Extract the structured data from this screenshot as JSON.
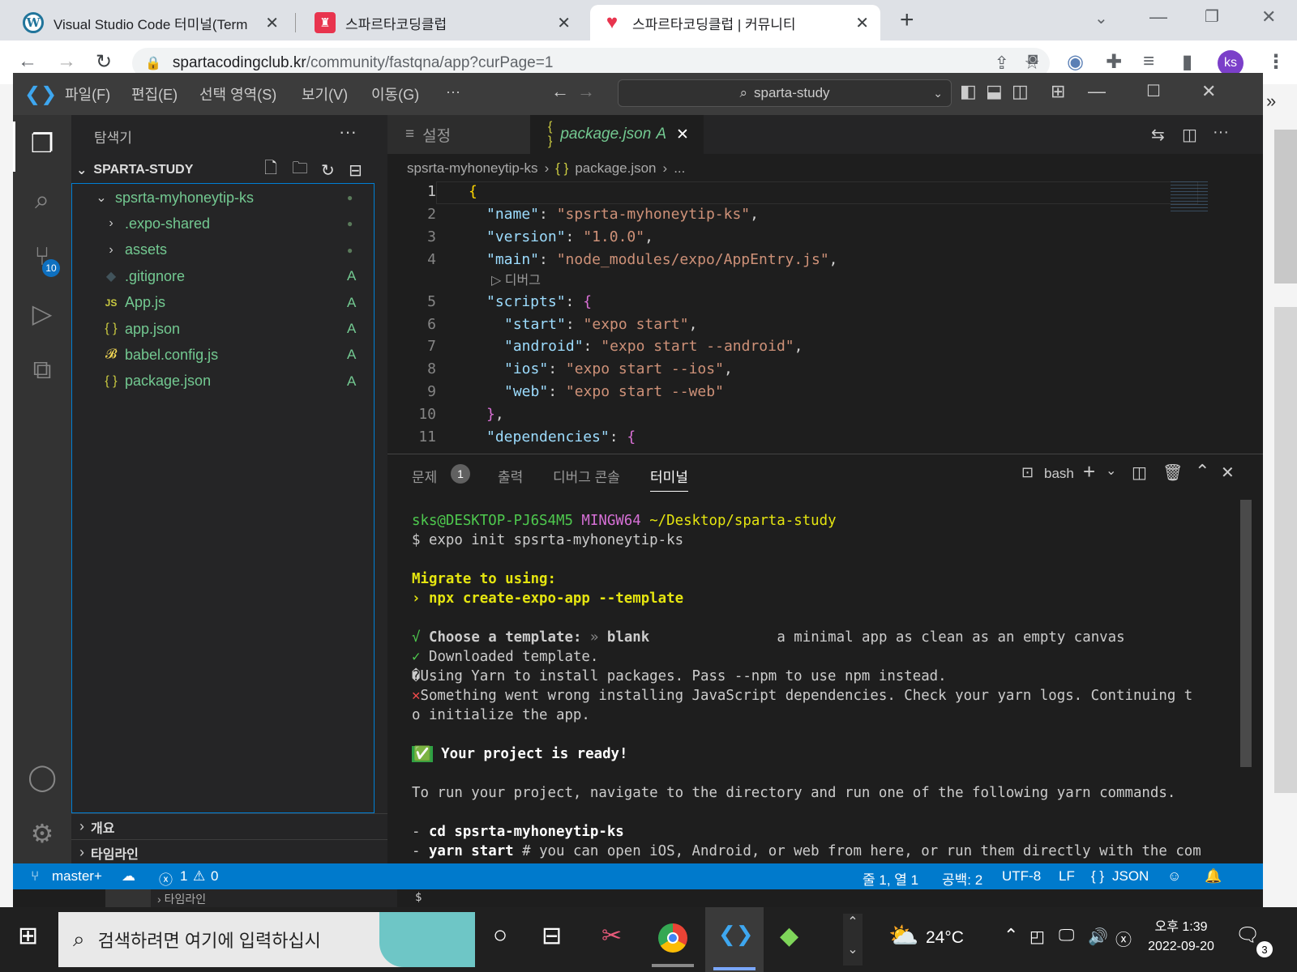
{
  "browser": {
    "tabs": [
      {
        "title": "Visual Studio Code 터미널(Term",
        "icon": "wordpress-icon"
      },
      {
        "title": "스파르타코딩클럽",
        "icon": "sparta-icon"
      },
      {
        "title": "스파르타코딩클럽 | 커뮤니티",
        "icon": "sparta-heart-icon"
      }
    ],
    "url_host": "spartacodingclub.kr",
    "url_path": "/community/fastqna/app?curPage=1",
    "profile": "ks"
  },
  "vscode": {
    "menu": [
      "파일(F)",
      "편집(E)",
      "선택 영역(S)",
      "보기(V)",
      "이동(G)",
      "···"
    ],
    "search": "sparta-study",
    "scm_badge": "10",
    "explorer_title": "탐색기",
    "workspace": "SPARTA-STUDY",
    "tree": [
      {
        "name": "spsrta-myhoneytip-ks",
        "kind": "folder-open",
        "badge": "●",
        "indent": 0
      },
      {
        "name": ".expo-shared",
        "kind": "folder",
        "badge": "●",
        "indent": 1
      },
      {
        "name": "assets",
        "kind": "folder",
        "badge": "●",
        "indent": 1
      },
      {
        "name": ".gitignore",
        "kind": "git",
        "badge": "A",
        "indent": 1
      },
      {
        "name": "App.js",
        "kind": "js",
        "badge": "A",
        "indent": 1
      },
      {
        "name": "app.json",
        "kind": "json",
        "badge": "A",
        "indent": 1
      },
      {
        "name": "babel.config.js",
        "kind": "babel",
        "badge": "A",
        "indent": 1
      },
      {
        "name": "package.json",
        "kind": "json",
        "badge": "A",
        "indent": 1
      }
    ],
    "outline_label": "개요",
    "timeline_label": "타임라인",
    "editor_tabs": [
      {
        "label": "설정"
      },
      {
        "label": "package.json",
        "badge": "A"
      }
    ],
    "breadcrumb": [
      "spsrta-myhoneytip-ks",
      "{ }",
      "package.json",
      "..."
    ],
    "codelens": "디버그",
    "panel_tabs": [
      "문제",
      "출력",
      "디버그 콘솔",
      "터미널"
    ],
    "problems_count": "1",
    "shell": "bash",
    "status": {
      "branch": "master+",
      "errors": "1",
      "warnings": "0",
      "position": "줄 1, 열 1",
      "spaces": "공백: 2",
      "encoding": "UTF-8",
      "eol": "LF",
      "language": "JSON"
    }
  },
  "code_lines": [
    {
      "n": "1",
      "text": "{"
    },
    {
      "n": "2",
      "text": "\"name\": \"spsrta-myhoneytip-ks\","
    },
    {
      "n": "3",
      "text": "\"version\": \"1.0.0\","
    },
    {
      "n": "4",
      "text": "\"main\": \"node_modules/expo/AppEntry.js\","
    },
    {
      "n": "5",
      "text": "\"scripts\": {"
    },
    {
      "n": "6",
      "text": "\"start\": \"expo start\","
    },
    {
      "n": "7",
      "text": "\"android\": \"expo start --android\","
    },
    {
      "n": "8",
      "text": "\"ios\": \"expo start --ios\","
    },
    {
      "n": "9",
      "text": "\"web\": \"expo start --web\""
    },
    {
      "n": "10",
      "text": "},"
    },
    {
      "n": "11",
      "text": "\"dependencies\": {"
    }
  ],
  "terminal": {
    "prompt_user": "sks@DESKTOP-PJ6S4M5",
    "prompt_env": "MINGW64",
    "prompt_dir": "~/Desktop/sparta-study",
    "cmd": "$ expo init spsrta-myhoneytip-ks",
    "migrate1": "Migrate to using:",
    "migrate2": "› npx create-expo-app --template",
    "choose_mark": "√",
    "choose_label": "Choose a template:",
    "choose_sep": "»",
    "choose_value": "blank",
    "choose_desc": "a minimal app as clean as an empty canvas",
    "downloaded_mark": "✓",
    "downloaded": "Downloaded template.",
    "yarn": "�Using Yarn to install packages. Pass --npm to use npm instead.",
    "err_mark": "✕",
    "err1": "Something went wrong installing JavaScript dependencies. Check your yarn logs. Continuing t",
    "err2": "o initialize the app.",
    "ready_mark": "✅",
    "ready": "Your project is ready!",
    "run": "To run your project, navigate to the directory and run one of the following yarn commands.",
    "cd_prefix": "- ",
    "cd": "cd spsrta-myhoneytip-ks",
    "start_prefix": "- ",
    "start": "yarn start",
    "start_rest": " # you can open iOS, Android, or web from here, or run them directly with the com"
  },
  "taskbar": {
    "search": "검색하려면 여기에 입력하십시",
    "temp": "24°C",
    "time": "오후 1:39",
    "date": "2022-09-20",
    "notif": "3"
  },
  "bg": {
    "timeline": "타임라인",
    "prompt": "$ "
  }
}
